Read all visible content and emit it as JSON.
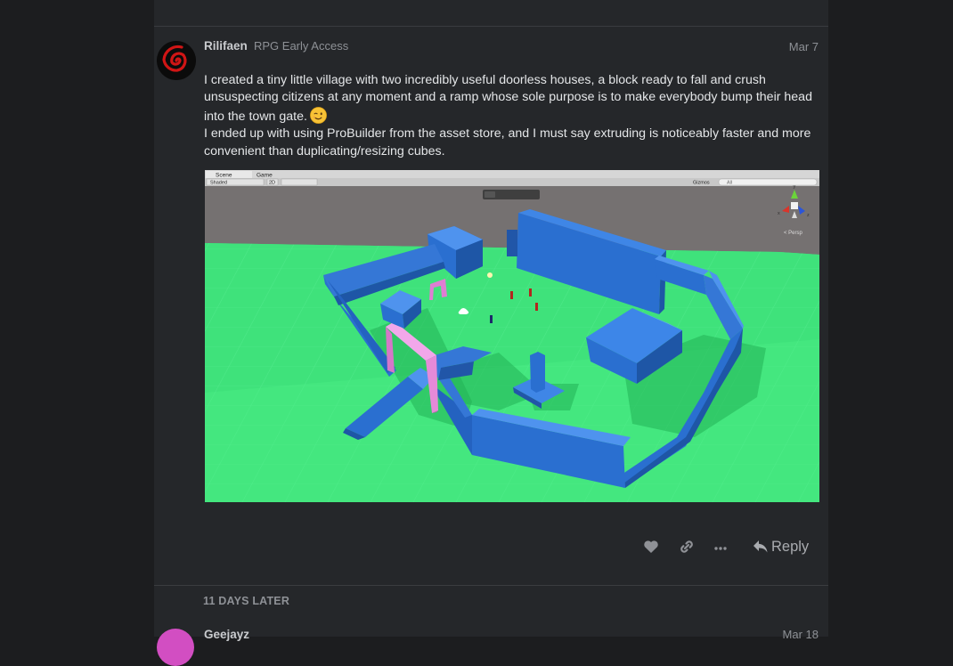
{
  "post": {
    "username": "Rilifaen",
    "user_title": "RPG Early Access",
    "date": "Mar 7",
    "paragraph1": "I created a tiny little village with two incredibly useful doorless houses, a block ready to fall and crush unsuspecting citizens at any moment and a ramp whose sole purpose is to make everybody bump their head into the town gate.",
    "paragraph2": "I ended up with using ProBuilder from the asset store, and I must say extruding is noticeably faster and more convenient than duplicating/resizing cubes.",
    "emoji": "wink-emoji"
  },
  "editor": {
    "tab_scene": "Scene",
    "tab_game": "Game",
    "shading_mode": "Shaded",
    "mode_2d": "2D",
    "gizmos_label": "Gizmos",
    "search_placeholder": "All",
    "view_label": "< Persp",
    "axis_y": "y",
    "axis_x": "x",
    "axis_z": "z",
    "colors": {
      "ground": "#3fe27b",
      "walls": "#2a6fd0",
      "gate": "#e58ad8",
      "sky": "#757171"
    }
  },
  "actions": {
    "like_icon": "heart-icon",
    "link_icon": "link-icon",
    "more_icon": "ellipsis-icon",
    "reply_label": "Reply"
  },
  "timeline_gap": "11 DAYS LATER",
  "next_post": {
    "username": "Geejayz",
    "date": "Mar 18"
  }
}
